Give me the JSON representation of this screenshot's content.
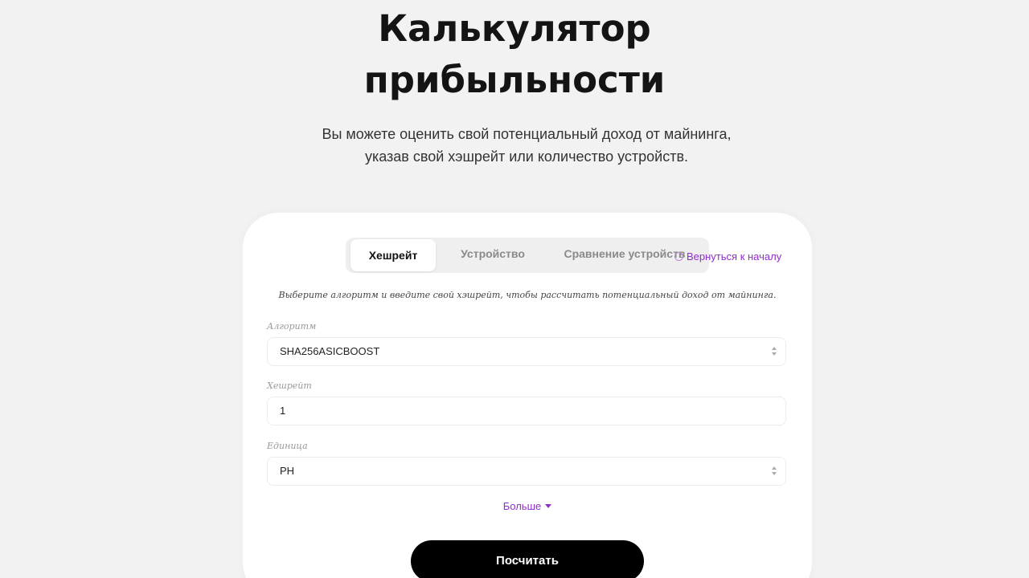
{
  "header": {
    "title_line1": "Калькулятор",
    "title_line2": "прибыльности",
    "subtitle_line1": "Вы можете оценить свой потенциальный доход от майнинга,",
    "subtitle_line2": "указав свой хэшрейт или количество устройств."
  },
  "tabs": [
    {
      "label": "Хешрейт",
      "active": true
    },
    {
      "label": "Устройство",
      "active": false
    },
    {
      "label": "Сравнение устройств",
      "active": false
    }
  ],
  "back_link": {
    "label": "Вернуться к началу",
    "icon": "circle-back-icon"
  },
  "form": {
    "hint": "Выберите алгоритм и введите свой хэшрейт, чтобы рассчитать потенциальный доход от майнинга.",
    "algorithm": {
      "label": "Алгоритм",
      "value": "SHA256ASICBOOST"
    },
    "hashrate": {
      "label": "Хешрейт",
      "value": "1"
    },
    "unit": {
      "label": "Единица",
      "value": "PH"
    },
    "more_label": "Больше",
    "submit_label": "Посчитать"
  },
  "colors": {
    "accent": "#8e2fc7",
    "background": "#f2f2f2",
    "button": "#000000"
  }
}
